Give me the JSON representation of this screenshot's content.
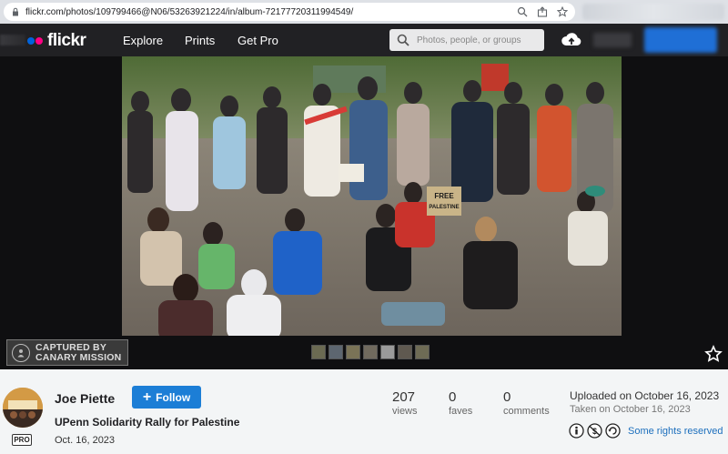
{
  "browser": {
    "url": "flickr.com/photos/109799466@N06/53263921224/in/album-72177720311994549/"
  },
  "header": {
    "logo": "flickr",
    "nav": [
      "Explore",
      "Prints",
      "Get Pro"
    ],
    "search_placeholder": "Photos, people, or groups"
  },
  "photo": {
    "watermark_line1": "CAPTURED BY",
    "watermark_line2": "CANARY MISSION",
    "sign_text_1": "FREE",
    "sign_text_2": "PALESTINE"
  },
  "owner": {
    "name": "Joe Piette",
    "follow_label": "Follow",
    "pro_label": "PRO"
  },
  "details": {
    "title": "UPenn Solidarity Rally for Palestine",
    "date": "Oct. 16, 2023",
    "views_count": "207",
    "views_label": "views",
    "faves_count": "0",
    "faves_label": "faves",
    "comments_count": "0",
    "comments_label": "comments",
    "uploaded": "Uploaded on October 16, 2023",
    "taken": "Taken on October 16, 2023",
    "license": "Some rights reserved"
  },
  "colors": {
    "header_bg": "#212124",
    "accent_blue": "#1c7ed6",
    "flickr_blue": "#0063dc",
    "flickr_pink": "#ff0084",
    "link_blue": "#1c6fbd"
  }
}
